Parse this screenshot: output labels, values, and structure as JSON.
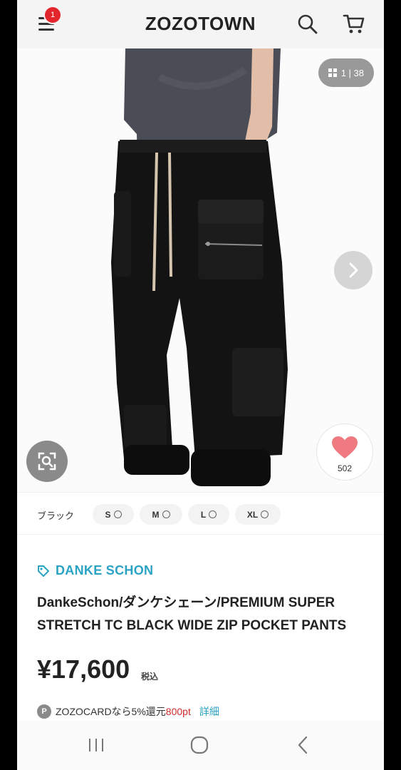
{
  "header": {
    "logo": "ZOZOTOWN",
    "menu_badge": "1",
    "icons": {
      "menu": "menu-icon",
      "search": "search-icon",
      "cart": "cart-icon"
    }
  },
  "gallery": {
    "counter": "1 | 38",
    "favorite_count": "502",
    "icons": {
      "grid": "grid-icon",
      "next": "chevron-right-icon",
      "lens": "image-search-icon",
      "heart": "heart-icon"
    }
  },
  "sizes": {
    "color": "ブラック",
    "options": [
      {
        "label": "S"
      },
      {
        "label": "M"
      },
      {
        "label": "L"
      },
      {
        "label": "XL"
      }
    ]
  },
  "product": {
    "brand": "DANKE SCHON",
    "title": "DankeSchon/ダンケシェーン/PREMIUM SUPER STRETCH TC BLACK WIDE ZIP POCKET PANTS",
    "price": "¥17,600",
    "tax_label": "税込"
  },
  "zozocard": {
    "badge": "P",
    "text": "ZOZOCARDなら5%還元",
    "points": "800pt",
    "link": "詳細"
  },
  "colors": {
    "accent": "#2aa3c4",
    "badge": "#e3262c",
    "heart": "#f07a82",
    "points": "#d22b2b"
  }
}
